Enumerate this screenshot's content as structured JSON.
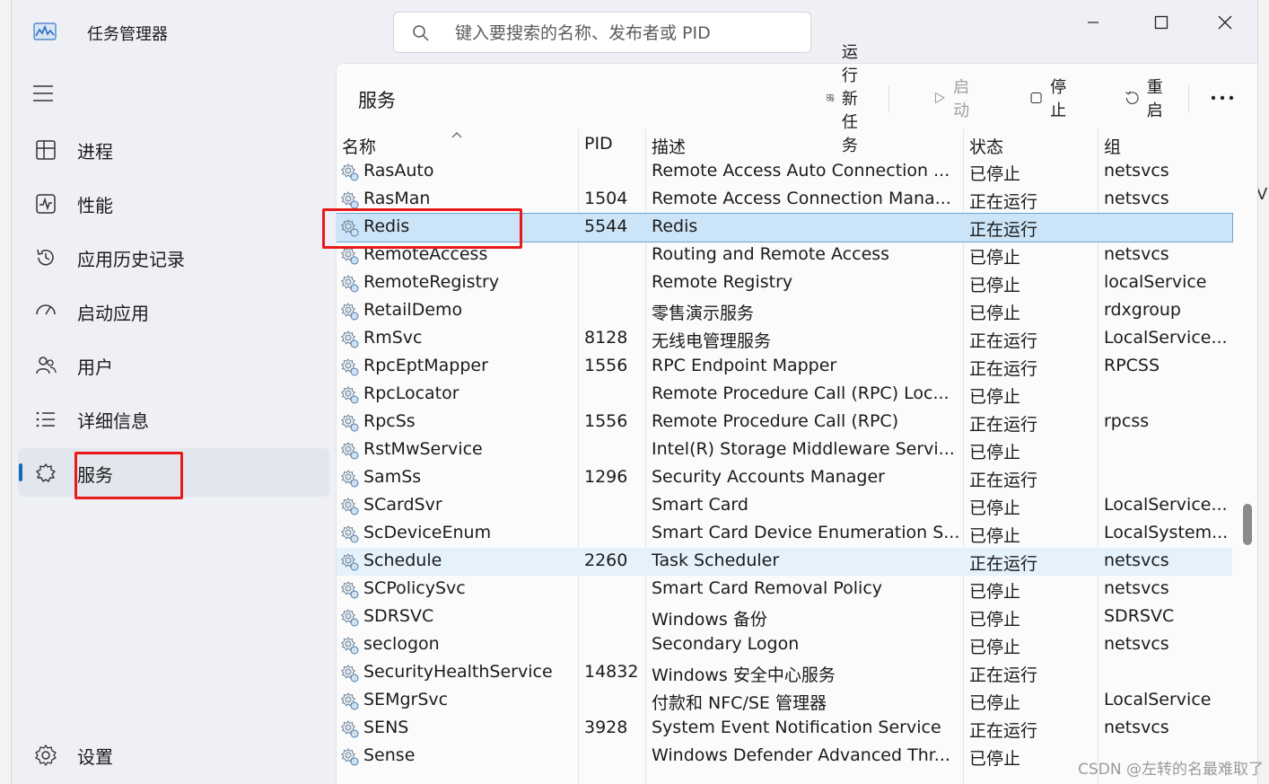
{
  "window": {
    "title": "任务管理器",
    "search_placeholder": "键入要搜索的名称、发布者或 PID"
  },
  "sidebar": {
    "items": [
      {
        "label": "进程",
        "icon": "processes-icon"
      },
      {
        "label": "性能",
        "icon": "performance-icon"
      },
      {
        "label": "应用历史记录",
        "icon": "app-history-icon"
      },
      {
        "label": "启动应用",
        "icon": "startup-apps-icon"
      },
      {
        "label": "用户",
        "icon": "users-icon"
      },
      {
        "label": "详细信息",
        "icon": "details-icon"
      },
      {
        "label": "服务",
        "icon": "services-icon",
        "active": true
      }
    ],
    "settings_label": "设置"
  },
  "main": {
    "title": "服务",
    "toolbar": {
      "run_new_task": "运行新任务",
      "start": "启动",
      "stop": "停止",
      "restart": "重启"
    }
  },
  "table": {
    "headers": {
      "name": "名称",
      "pid": "PID",
      "desc": "描述",
      "status": "状态",
      "group": "组"
    },
    "rows": [
      {
        "name": "RasAuto",
        "pid": "",
        "desc": "Remote Access Auto Connection ...",
        "status": "已停止",
        "group": "netsvcs"
      },
      {
        "name": "RasMan",
        "pid": "1504",
        "desc": "Remote Access Connection Mana...",
        "status": "正在运行",
        "group": "netsvcs"
      },
      {
        "name": "Redis",
        "pid": "5544",
        "desc": "Redis",
        "status": "正在运行",
        "group": "",
        "selected": true
      },
      {
        "name": "RemoteAccess",
        "pid": "",
        "desc": "Routing and Remote Access",
        "status": "已停止",
        "group": "netsvcs"
      },
      {
        "name": "RemoteRegistry",
        "pid": "",
        "desc": "Remote Registry",
        "status": "已停止",
        "group": "localService"
      },
      {
        "name": "RetailDemo",
        "pid": "",
        "desc": "零售演示服务",
        "status": "已停止",
        "group": "rdxgroup"
      },
      {
        "name": "RmSvc",
        "pid": "8128",
        "desc": "无线电管理服务",
        "status": "正在运行",
        "group": "LocalService..."
      },
      {
        "name": "RpcEptMapper",
        "pid": "1556",
        "desc": "RPC Endpoint Mapper",
        "status": "正在运行",
        "group": "RPCSS"
      },
      {
        "name": "RpcLocator",
        "pid": "",
        "desc": "Remote Procedure Call (RPC) Loc...",
        "status": "已停止",
        "group": ""
      },
      {
        "name": "RpcSs",
        "pid": "1556",
        "desc": "Remote Procedure Call (RPC)",
        "status": "正在运行",
        "group": "rpcss"
      },
      {
        "name": "RstMwService",
        "pid": "",
        "desc": "Intel(R) Storage Middleware Servi...",
        "status": "已停止",
        "group": ""
      },
      {
        "name": "SamSs",
        "pid": "1296",
        "desc": "Security Accounts Manager",
        "status": "正在运行",
        "group": ""
      },
      {
        "name": "SCardSvr",
        "pid": "",
        "desc": "Smart Card",
        "status": "已停止",
        "group": "LocalService..."
      },
      {
        "name": "ScDeviceEnum",
        "pid": "",
        "desc": "Smart Card Device Enumeration S...",
        "status": "已停止",
        "group": "LocalSystem..."
      },
      {
        "name": "Schedule",
        "pid": "2260",
        "desc": "Task Scheduler",
        "status": "正在运行",
        "group": "netsvcs",
        "highlight": true
      },
      {
        "name": "SCPolicySvc",
        "pid": "",
        "desc": "Smart Card Removal Policy",
        "status": "已停止",
        "group": "netsvcs"
      },
      {
        "name": "SDRSVC",
        "pid": "",
        "desc": "Windows 备份",
        "status": "已停止",
        "group": "SDRSVC"
      },
      {
        "name": "seclogon",
        "pid": "",
        "desc": "Secondary Logon",
        "status": "已停止",
        "group": "netsvcs"
      },
      {
        "name": "SecurityHealthService",
        "pid": "14832",
        "desc": "Windows 安全中心服务",
        "status": "正在运行",
        "group": ""
      },
      {
        "name": "SEMgrSvc",
        "pid": "",
        "desc": "付款和 NFC/SE 管理器",
        "status": "已停止",
        "group": "LocalService"
      },
      {
        "name": "SENS",
        "pid": "3928",
        "desc": "System Event Notification Service",
        "status": "正在运行",
        "group": "netsvcs"
      },
      {
        "name": "Sense",
        "pid": "",
        "desc": "Windows Defender Advanced Thr...",
        "status": "已停止",
        "group": ""
      }
    ]
  },
  "watermark": "CSDN @左转的名最难取了",
  "colors": {
    "accent": "#0f6cbd",
    "annotation": "#e81b1b",
    "selected_row": "#cce4f7"
  }
}
